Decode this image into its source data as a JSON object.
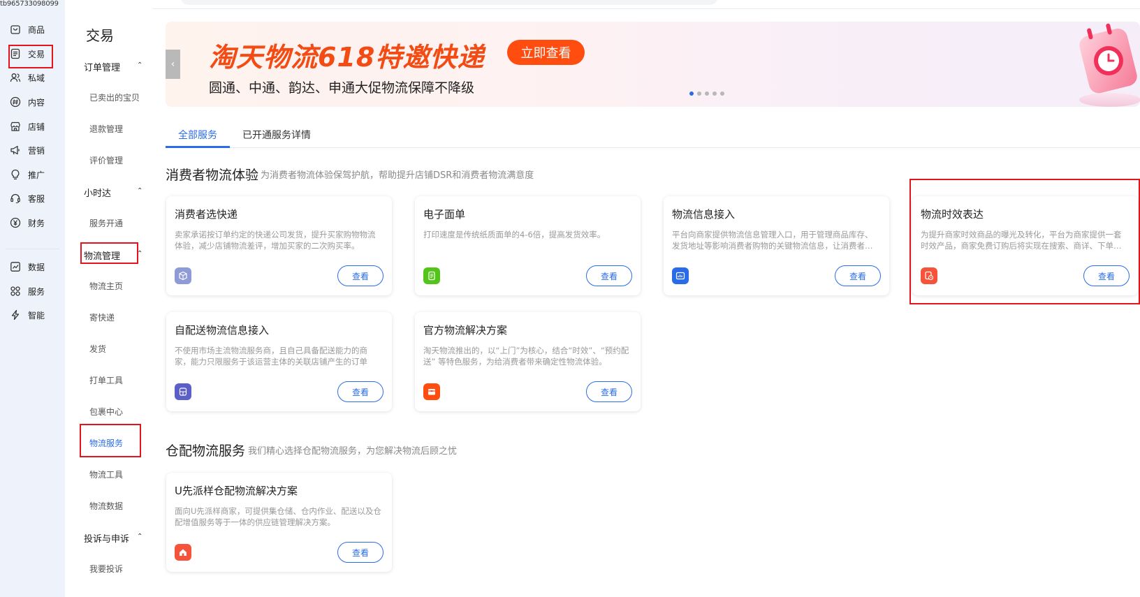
{
  "user": {
    "id": "tb965733098099"
  },
  "rail": {
    "items": [
      {
        "label": "商品"
      },
      {
        "label": "交易"
      },
      {
        "label": "私域"
      },
      {
        "label": "内容"
      },
      {
        "label": "店铺"
      },
      {
        "label": "营销"
      },
      {
        "label": "推广"
      },
      {
        "label": "客服"
      },
      {
        "label": "财务"
      },
      {
        "label": "数据"
      },
      {
        "label": "服务"
      },
      {
        "label": "智能"
      }
    ]
  },
  "subnav": {
    "title": "交易",
    "groups": [
      {
        "label": "订单管理",
        "items": [
          "已卖出的宝贝",
          "退款管理",
          "评价管理"
        ]
      },
      {
        "label": "小时达",
        "items": [
          "服务开通"
        ]
      },
      {
        "label": "物流管理",
        "items": [
          "物流主页",
          "寄快递",
          "发货",
          "打单工具",
          "包裹中心",
          "物流服务",
          "物流工具",
          "物流数据"
        ]
      },
      {
        "label": "投诉与申诉",
        "items": [
          "我要投诉"
        ]
      }
    ],
    "active_item": "物流服务"
  },
  "banner": {
    "title": "淘天物流618特邀快递",
    "button": "立即查看",
    "subtitle": "圆通、中通、韵达、申通大促物流保障不降级",
    "slide_count": 5,
    "active_slide": 1,
    "prev_arrow": "‹"
  },
  "tabs": [
    {
      "label": "全部服务",
      "active": true
    },
    {
      "label": "已开通服务详情",
      "active": false
    }
  ],
  "sections": [
    {
      "title": "消费者物流体验",
      "desc": "为消费者物流体验保驾护航，帮助提升店铺DSR和消费者物流满意度",
      "cards": [
        {
          "title": "消费者选快递",
          "desc": "卖家承诺按订单约定的快递公司发货，提升买家购物物流体验，减少店铺物流差评，增加买家的二次购买率。",
          "button": "查看",
          "icon": "box-icon",
          "icon_color": "#8f9bd6"
        },
        {
          "title": "电子面单",
          "desc": "打印速度是传统纸质面单的4-6倍，提高发货效率。",
          "button": "查看",
          "icon": "document-icon",
          "icon_color": "#52c41a"
        },
        {
          "title": "物流信息接入",
          "desc": "平台向商家提供物流信息管理入口，用于管理商品库存、发货地址等影响消费者购物的关键物流信息，让消费者购物更放心。",
          "button": "查看",
          "icon": "data-icon",
          "icon_color": "#2a6ce8"
        },
        {
          "title": "物流时效表达",
          "desc": "为提升商家时效商品的曝光及转化，平台为商家提供一套时效产品，商家免费订购后将实现在搜索、商详、下单等页面展示。",
          "button": "查看",
          "icon": "clock-document-icon",
          "icon_color": "#f5543a"
        },
        {
          "title": "自配送物流信息接入",
          "desc": "不使用市场主流物流服务商，且自己具备配送能力的商家，能力只限服务于该运营主体的关联店铺产生的订单",
          "button": "查看",
          "icon": "truck-icon",
          "icon_color": "#5b5fc7"
        },
        {
          "title": "官方物流解决方案",
          "desc": "淘天物流推出的，以“上门”为核心，结合“时效”、“预约配送” 等特色服务，为给消费者带来确定性物流体验。",
          "button": "查看",
          "icon": "package-icon",
          "icon_color": "#ff4d10"
        }
      ]
    },
    {
      "title": "仓配物流服务",
      "desc": "我们精心选择仓配物流服务，为您解决物流后顾之忧",
      "cards": [
        {
          "title": "U先派样仓配物流解决方案",
          "desc": "面向U先派样商家，可提供集仓储、仓内作业、配送以及仓配增值服务等于一体的供应链管理解决方案。",
          "button": "查看",
          "icon": "home-icon",
          "icon_color": "#f5543a"
        }
      ]
    }
  ],
  "colors": {
    "accent": "#2a6ce8",
    "highlight": "#e4141c",
    "banner_title": "#f24c14",
    "banner_button": "#ff4d10",
    "rail_bg": "#eef2fa"
  }
}
